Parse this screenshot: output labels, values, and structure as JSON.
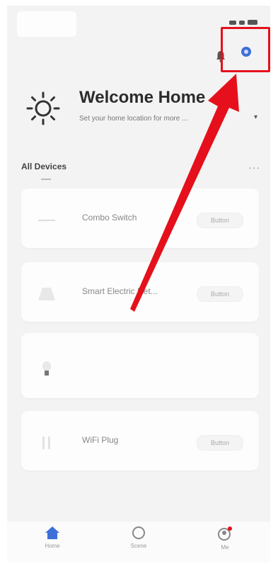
{
  "header": {
    "title": "Welcome Home",
    "subtitle": "Set your home location for more ...",
    "chevron": "▾"
  },
  "devices": {
    "section_title": "All Devices",
    "more": "···",
    "items": [
      {
        "name": "Combo Switch",
        "toggle": "Button",
        "icon": "switch-icon"
      },
      {
        "name": "Smart Electric Ret...",
        "toggle": "Button",
        "icon": "lamp-icon"
      },
      {
        "name": "",
        "toggle": "",
        "icon": "bulb-icon"
      },
      {
        "name": "WiFi Plug",
        "toggle": "Button",
        "icon": "plug-icon"
      }
    ]
  },
  "tabs": [
    {
      "label": "Home",
      "icon": "home-icon"
    },
    {
      "label": "Scene",
      "icon": "scene-icon"
    },
    {
      "label": "Me",
      "icon": "me-icon"
    }
  ],
  "colors": {
    "accent": "#3d6fd8",
    "highlight": "#e5101b"
  }
}
